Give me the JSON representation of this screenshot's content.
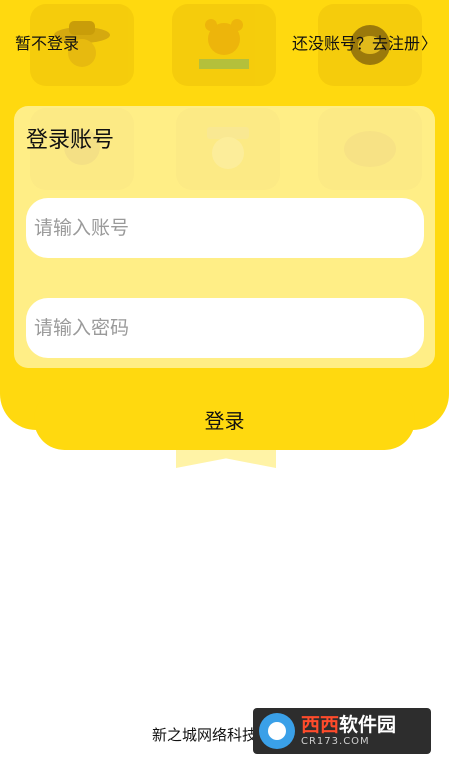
{
  "top_bar": {
    "skip_label": "暂不登录",
    "register_label": "还没账号？去注册",
    "register_chevron": "〉"
  },
  "login_form": {
    "title": "登录账号",
    "account_placeholder": "请输入账号",
    "password_placeholder": "请输入密码",
    "login_button": "登录"
  },
  "footer": {
    "company": "新之城网络科技"
  },
  "watermark": {
    "brand_red": "西西",
    "brand_white": "软件园",
    "url": "CR173.COM"
  },
  "colors": {
    "accent": "#FFD90F",
    "panel": "#FFF5B4",
    "watermark_bg": "#2D2D2D"
  },
  "icons": [
    "cowboy-character-icon",
    "bear-character-icon",
    "sun-character-icon",
    "knight-character-icon",
    "old-man-character-icon",
    "dinosaur-character-icon"
  ]
}
